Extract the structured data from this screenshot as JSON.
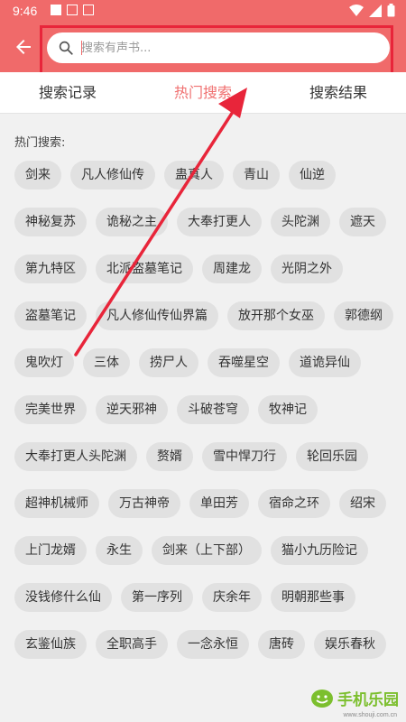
{
  "status_bar": {
    "time": "9:46",
    "left_icons": [
      "square-icon",
      "notification-a-icon",
      "keyboard-icon"
    ],
    "right_icons": [
      "wifi-icon",
      "signal-icon",
      "battery-icon"
    ]
  },
  "app_bar": {
    "back_icon": "arrow-left-icon",
    "search_placeholder": "搜索有声书...",
    "search_value": "",
    "accent_color": "#f06a6a"
  },
  "tabs": [
    {
      "label": "搜索记录",
      "active": false
    },
    {
      "label": "热门搜索",
      "active": true
    },
    {
      "label": "搜索结果",
      "active": false
    }
  ],
  "hot": {
    "title": "热门搜索:",
    "tags": [
      "剑来",
      "凡人修仙传",
      "蛊真人",
      "青山",
      "仙逆",
      "神秘复苏",
      "诡秘之主",
      "大奉打更人",
      "头陀渊",
      "遮天",
      "第九特区",
      "北派盗墓笔记",
      "周建龙",
      "光阴之外",
      "盗墓笔记",
      "凡人修仙传仙界篇",
      "放开那个女巫",
      "郭德纲",
      "鬼吹灯",
      "三体",
      "捞尸人",
      "吞噬星空",
      "道诡异仙",
      "完美世界",
      "逆天邪神",
      "斗破苍穹",
      "牧神记",
      "大奉打更人头陀渊",
      "赘婿",
      "雪中悍刀行",
      "轮回乐园",
      "超神机械师",
      "万古神帝",
      "单田芳",
      "宿命之环",
      "绍宋",
      "上门龙婿",
      "永生",
      "剑来（上下部）",
      "猫小九历险记",
      "没钱修什么仙",
      "第一序列",
      "庆余年",
      "明朝那些事",
      "玄鉴仙族",
      "全职高手",
      "一念永恒",
      "唐砖",
      "娱乐春秋"
    ]
  },
  "annotation": {
    "box_color": "#e8253a"
  },
  "watermark": {
    "text": "手机乐园",
    "url": "www.shouji.com.cn"
  }
}
